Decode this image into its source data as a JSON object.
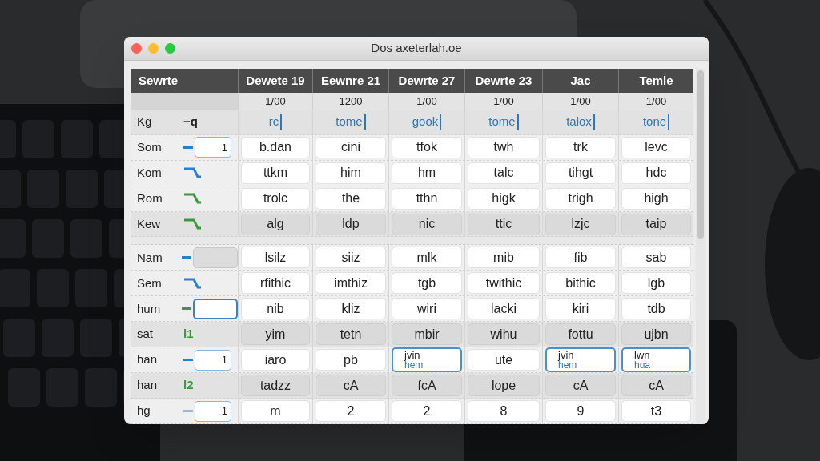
{
  "window": {
    "title": "Dos axeterlah.oe"
  },
  "table": {
    "row_header_label": "Sewrte",
    "columns": [
      {
        "label": "Dewete 19",
        "sub": "1/00"
      },
      {
        "label": "Eewnre 21",
        "sub": "1200"
      },
      {
        "label": "Dewrte 27",
        "sub": "1/00"
      },
      {
        "label": "Dewrte 23",
        "sub": "1/00"
      },
      {
        "label": "Jac",
        "sub": "1/00"
      },
      {
        "label": "Temle",
        "sub": "1/00"
      }
    ],
    "rows": [
      {
        "head": {
          "label": "Kg",
          "marker": {
            "kind": "number",
            "color": "#222222",
            "text": "−q"
          }
        },
        "kind": "editing",
        "cells": [
          "rc",
          "tome",
          "gook",
          "tome",
          "talox",
          "tone"
        ]
      },
      {
        "head": {
          "label": "Som",
          "marker": {
            "kind": "stepper",
            "color": "#2a7fd4",
            "text": "1"
          }
        },
        "kind": "raised",
        "cells": [
          "b.dan",
          "cini",
          "tfok",
          "twh",
          "trk",
          "levc"
        ]
      },
      {
        "head": {
          "label": "Kom",
          "marker": {
            "kind": "curve",
            "color": "#2a7fd4"
          }
        },
        "kind": "raised",
        "cells": [
          "ttkm",
          "him",
          "hm",
          "talc",
          "tihgt",
          "hdc"
        ]
      },
      {
        "head": {
          "label": "Rom",
          "marker": {
            "kind": "curve",
            "color": "#3a9a3a"
          }
        },
        "kind": "raised",
        "cells": [
          "trolc",
          "the",
          "tthn",
          "higk",
          "trigh",
          "high"
        ]
      },
      {
        "head": {
          "label": "Kew",
          "marker": {
            "kind": "curve",
            "color": "#3a9a3a"
          }
        },
        "kind": "flat",
        "cells": [
          "alg",
          "ldp",
          "nic",
          "ttic",
          "lzjc",
          "taip"
        ],
        "spacer_after": true
      },
      {
        "head": {
          "label": "Nam",
          "marker": {
            "kind": "field",
            "color": "#2a7fd4",
            "focused": false
          }
        },
        "kind": "raised",
        "cells": [
          "lsilz",
          "siiz",
          "mlk",
          "mib",
          "fib",
          "sab"
        ]
      },
      {
        "head": {
          "label": "Sem",
          "marker": {
            "kind": "curve",
            "color": "#2a7fd4"
          }
        },
        "kind": "raised",
        "cells": [
          "rfithic",
          "imthiz",
          "tgb",
          "twithic",
          "bithic",
          "lgb"
        ]
      },
      {
        "head": {
          "label": "hum",
          "marker": {
            "kind": "field",
            "color": "#3a9a3a",
            "focused": true
          }
        },
        "kind": "raised",
        "cells": [
          "nib",
          "kliz",
          "wiri",
          "lacki",
          "kiri",
          "tdb"
        ]
      },
      {
        "head": {
          "label": "sat",
          "marker": {
            "kind": "number",
            "color": "#3a9a3a",
            "text": "l1"
          }
        },
        "kind": "flat",
        "cells": [
          "yim",
          "tetn",
          "mbir",
          "wihu",
          "fottu",
          "ujbn"
        ]
      },
      {
        "head": {
          "label": "han",
          "marker": {
            "kind": "stepper",
            "color": "#2a7fd4",
            "text": "1"
          }
        },
        "kind": "raised",
        "cells": [
          {
            "text": "iaro",
            "focused": false
          },
          {
            "text": "pb",
            "focused": false
          },
          {
            "text": "jvin",
            "subtext": "hem",
            "focused": true
          },
          {
            "text": "ute",
            "focused": false
          },
          {
            "text": "jvin",
            "subtext": "hem",
            "focused": true
          },
          {
            "text": "lwn",
            "subtext": "hua",
            "focused": true
          }
        ]
      },
      {
        "head": {
          "label": "han",
          "marker": {
            "kind": "number",
            "color": "#3a9a3a",
            "text": "l2"
          }
        },
        "kind": "flat",
        "cells": [
          "tadzz",
          "cA",
          "fcA",
          "lope",
          "cA",
          "cA"
        ]
      },
      {
        "head": {
          "label": "hg",
          "marker": {
            "kind": "stepper",
            "color": "#9ab8d8",
            "text": "1"
          }
        },
        "kind": "raised",
        "cells": [
          "m",
          "2",
          "2",
          "8",
          "9",
          "t3"
        ]
      }
    ]
  }
}
